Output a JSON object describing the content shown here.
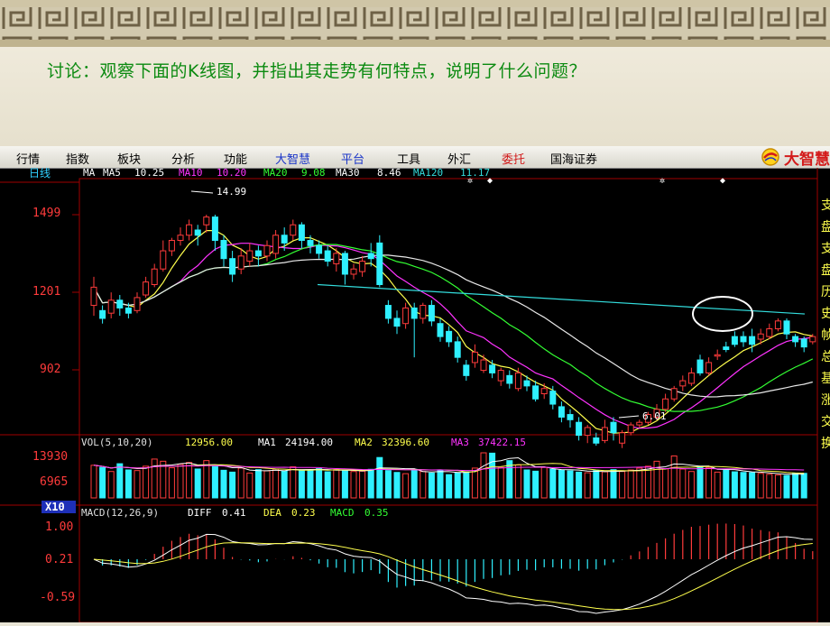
{
  "slide": {
    "question": "讨论：观察下面的K线图，并指出其走势有何特点，说明了什么问题？"
  },
  "menu": {
    "items": [
      {
        "label": "行情",
        "style": "normal"
      },
      {
        "label": "指数",
        "style": "normal"
      },
      {
        "label": "板块",
        "style": "normal"
      },
      {
        "label": "分析",
        "style": "normal"
      },
      {
        "label": "功能",
        "style": "normal"
      },
      {
        "label": "大智慧",
        "style": "blue"
      },
      {
        "label": "平台",
        "style": "blue"
      },
      {
        "label": "工具",
        "style": "normal"
      },
      {
        "label": "外汇",
        "style": "normal"
      },
      {
        "label": "委托",
        "style": "red"
      },
      {
        "label": "国海证券",
        "style": "normal"
      }
    ],
    "logo_text": "大智慧"
  },
  "colors": {
    "up": "#ff3b3b",
    "down": "#2ff0ff",
    "ma5": "#e8e8e8",
    "ma10": "#ffff4d",
    "ma20": "#ff33ff",
    "ma30": "#33ff33",
    "ma120": "#33dddd",
    "axis": "#c00000",
    "question": "#0b8a10"
  },
  "price_panel": {
    "period_label": "日线",
    "ma_prefix": "MA",
    "ma_legend": [
      {
        "label": "MA5",
        "value": "10.25",
        "color": "#ffffff"
      },
      {
        "label": "MA10",
        "value": "10.20",
        "color": "#ffff4d"
      },
      {
        "label": "MA20",
        "value": "9.08",
        "color": "#ff33ff"
      },
      {
        "label": "MA30",
        "value": "8.46",
        "color": "#33ff33"
      },
      {
        "label": "MA120",
        "value": "11.17",
        "color": "#33dddd"
      }
    ],
    "y_ticks": [
      "1499",
      "1201",
      "902"
    ],
    "high_label": "14.99",
    "low_label": "6.01",
    "right_glyphs": [
      "支",
      "盘",
      "支",
      "盘",
      "历",
      "史",
      "帧",
      "总",
      "基",
      "涨",
      "交",
      "换"
    ]
  },
  "volume_panel": {
    "title": "VOL(5,10,20)",
    "vol_value": "12956.00",
    "ma1_label": "MA1",
    "ma1_value": "24194.00",
    "ma2_label": "MA2",
    "ma2_value": "32396.60",
    "ma3_label": "MA3",
    "ma3_value": "37422.15",
    "y_ticks": [
      "13930",
      "6965"
    ],
    "unit": "X10"
  },
  "macd_panel": {
    "title": "MACD(12,26,9)",
    "diff_label": "DIFF",
    "diff_value": "0.41",
    "dea_label": "DEA",
    "dea_value": "0.23",
    "macd_label": "MACD",
    "macd_value": "0.35",
    "y_ticks": [
      "1.00",
      "0.21",
      "-0.59"
    ]
  },
  "chart_data": {
    "type": "candlestick",
    "period": "daily",
    "price_axis_ticks": [
      14.99,
      12.01,
      9.02
    ],
    "marked_high": 14.99,
    "marked_low": 6.01,
    "candles": [
      {
        "o": 11.5,
        "c": 12.2,
        "h": 12.6,
        "l": 11.1
      },
      {
        "o": 11.3,
        "c": 11.0,
        "h": 11.5,
        "l": 10.8
      },
      {
        "o": 11.2,
        "c": 11.7,
        "h": 12.0,
        "l": 11.0
      },
      {
        "o": 11.7,
        "c": 11.4,
        "h": 11.9,
        "l": 11.1
      },
      {
        "o": 11.4,
        "c": 11.2,
        "h": 11.6,
        "l": 11.0
      },
      {
        "o": 11.3,
        "c": 11.8,
        "h": 12.0,
        "l": 11.2
      },
      {
        "o": 11.9,
        "c": 12.4,
        "h": 12.6,
        "l": 11.8
      },
      {
        "o": 12.3,
        "c": 12.9,
        "h": 13.1,
        "l": 12.2
      },
      {
        "o": 12.9,
        "c": 13.6,
        "h": 14.0,
        "l": 12.8
      },
      {
        "o": 13.6,
        "c": 14.0,
        "h": 14.1,
        "l": 13.4
      },
      {
        "o": 14.0,
        "c": 14.2,
        "h": 14.5,
        "l": 13.8
      },
      {
        "o": 14.2,
        "c": 14.6,
        "h": 14.8,
        "l": 14.0
      },
      {
        "o": 14.4,
        "c": 14.2,
        "h": 14.6,
        "l": 13.8
      },
      {
        "o": 14.6,
        "c": 14.9,
        "h": 14.99,
        "l": 14.3
      },
      {
        "o": 14.9,
        "c": 14.0,
        "h": 14.99,
        "l": 13.6
      },
      {
        "o": 14.0,
        "c": 13.3,
        "h": 14.2,
        "l": 13.0
      },
      {
        "o": 13.3,
        "c": 12.7,
        "h": 13.6,
        "l": 12.4
      },
      {
        "o": 12.9,
        "c": 13.4,
        "h": 13.7,
        "l": 12.7
      },
      {
        "o": 13.2,
        "c": 13.6,
        "h": 13.9,
        "l": 13.0
      },
      {
        "o": 13.6,
        "c": 13.4,
        "h": 13.8,
        "l": 13.0
      },
      {
        "o": 13.4,
        "c": 13.8,
        "h": 14.0,
        "l": 13.2
      },
      {
        "o": 13.5,
        "c": 14.2,
        "h": 14.4,
        "l": 13.3
      },
      {
        "o": 14.2,
        "c": 13.9,
        "h": 14.5,
        "l": 13.6
      },
      {
        "o": 14.2,
        "c": 14.6,
        "h": 14.8,
        "l": 14.0
      },
      {
        "o": 14.6,
        "c": 14.0,
        "h": 14.7,
        "l": 13.7
      },
      {
        "o": 14.0,
        "c": 13.8,
        "h": 14.2,
        "l": 13.5
      },
      {
        "o": 13.8,
        "c": 13.5,
        "h": 14.0,
        "l": 13.3
      },
      {
        "o": 13.6,
        "c": 13.2,
        "h": 13.8,
        "l": 13.0
      },
      {
        "o": 13.1,
        "c": 13.5,
        "h": 13.7,
        "l": 12.8
      },
      {
        "o": 13.5,
        "c": 12.7,
        "h": 13.6,
        "l": 12.3
      },
      {
        "o": 12.7,
        "c": 12.9,
        "h": 13.1,
        "l": 12.5
      },
      {
        "o": 12.8,
        "c": 13.2,
        "h": 13.4,
        "l": 12.6
      },
      {
        "o": 13.5,
        "c": 13.3,
        "h": 13.9,
        "l": 13.0
      },
      {
        "o": 13.9,
        "c": 12.3,
        "h": 14.2,
        "l": 12.2
      },
      {
        "o": 11.5,
        "c": 11.0,
        "h": 11.7,
        "l": 10.8
      },
      {
        "o": 11.0,
        "c": 10.7,
        "h": 11.3,
        "l": 10.4
      },
      {
        "o": 10.8,
        "c": 11.4,
        "h": 11.6,
        "l": 10.6
      },
      {
        "o": 11.4,
        "c": 11.0,
        "h": 11.6,
        "l": 9.5
      },
      {
        "o": 11.0,
        "c": 11.5,
        "h": 11.6,
        "l": 10.8
      },
      {
        "o": 11.5,
        "c": 10.9,
        "h": 11.7,
        "l": 10.7
      },
      {
        "o": 10.8,
        "c": 10.3,
        "h": 11.0,
        "l": 10.1
      },
      {
        "o": 10.5,
        "c": 10.1,
        "h": 10.7,
        "l": 9.9
      },
      {
        "o": 10.1,
        "c": 9.5,
        "h": 10.3,
        "l": 9.3
      },
      {
        "o": 9.2,
        "c": 8.8,
        "h": 9.4,
        "l": 8.6
      },
      {
        "o": 9.3,
        "c": 9.7,
        "h": 10.0,
        "l": 9.1
      },
      {
        "o": 9.0,
        "c": 9.4,
        "h": 9.6,
        "l": 8.9
      },
      {
        "o": 9.2,
        "c": 8.9,
        "h": 9.4,
        "l": 8.7
      },
      {
        "o": 8.6,
        "c": 9.0,
        "h": 9.1,
        "l": 8.4
      },
      {
        "o": 8.8,
        "c": 8.5,
        "h": 9.0,
        "l": 8.3
      },
      {
        "o": 8.3,
        "c": 8.9,
        "h": 9.1,
        "l": 8.2
      },
      {
        "o": 8.6,
        "c": 8.4,
        "h": 8.8,
        "l": 8.2
      },
      {
        "o": 8.4,
        "c": 7.9,
        "h": 8.6,
        "l": 7.8
      },
      {
        "o": 8.1,
        "c": 8.3,
        "h": 8.5,
        "l": 7.9
      },
      {
        "o": 8.2,
        "c": 7.7,
        "h": 8.4,
        "l": 7.5
      },
      {
        "o": 7.6,
        "c": 7.2,
        "h": 7.8,
        "l": 7.0
      },
      {
        "o": 7.3,
        "c": 7.1,
        "h": 7.5,
        "l": 6.8
      },
      {
        "o": 7.0,
        "c": 6.5,
        "h": 7.2,
        "l": 6.3
      },
      {
        "o": 6.5,
        "c": 6.8,
        "h": 6.9,
        "l": 6.2
      },
      {
        "o": 6.4,
        "c": 6.2,
        "h": 6.6,
        "l": 6.1
      },
      {
        "o": 6.3,
        "c": 6.8,
        "h": 7.1,
        "l": 6.2
      },
      {
        "o": 7.0,
        "c": 6.6,
        "h": 7.2,
        "l": 6.3
      },
      {
        "o": 6.2,
        "c": 6.6,
        "h": 6.7,
        "l": 6.01
      },
      {
        "o": 6.6,
        "c": 6.9,
        "h": 7.0,
        "l": 6.5
      },
      {
        "o": 6.9,
        "c": 7.0,
        "h": 7.1,
        "l": 6.8
      },
      {
        "o": 7.0,
        "c": 7.3,
        "h": 7.4,
        "l": 6.9
      },
      {
        "o": 7.2,
        "c": 7.5,
        "h": 7.7,
        "l": 7.1
      },
      {
        "o": 7.5,
        "c": 7.9,
        "h": 8.1,
        "l": 7.4
      },
      {
        "o": 7.9,
        "c": 8.3,
        "h": 8.4,
        "l": 7.8
      },
      {
        "o": 8.4,
        "c": 8.6,
        "h": 8.8,
        "l": 8.2
      },
      {
        "o": 8.5,
        "c": 8.9,
        "h": 9.1,
        "l": 8.4
      },
      {
        "o": 9.4,
        "c": 8.9,
        "h": 9.6,
        "l": 8.8
      },
      {
        "o": 8.9,
        "c": 9.3,
        "h": 9.5,
        "l": 8.8
      },
      {
        "o": 9.6,
        "c": 9.6,
        "h": 9.8,
        "l": 9.4
      },
      {
        "o": 9.9,
        "c": 9.8,
        "h": 10.1,
        "l": 9.7
      },
      {
        "o": 10.3,
        "c": 10.0,
        "h": 10.5,
        "l": 9.9
      },
      {
        "o": 10.3,
        "c": 10.1,
        "h": 10.5,
        "l": 9.9
      },
      {
        "o": 10.3,
        "c": 10.0,
        "h": 10.6,
        "l": 9.7
      },
      {
        "o": 10.2,
        "c": 10.4,
        "h": 10.6,
        "l": 10.0
      },
      {
        "o": 10.3,
        "c": 10.6,
        "h": 10.8,
        "l": 10.2
      },
      {
        "o": 10.6,
        "c": 10.9,
        "h": 11.0,
        "l": 10.5
      },
      {
        "o": 10.9,
        "c": 10.4,
        "h": 11.0,
        "l": 10.2
      },
      {
        "o": 10.3,
        "c": 10.1,
        "h": 10.4,
        "l": 9.9
      },
      {
        "o": 10.2,
        "c": 9.9,
        "h": 10.3,
        "l": 9.7
      },
      {
        "o": 10.1,
        "c": 10.3,
        "h": 10.4,
        "l": 10.0
      }
    ],
    "volume_x10": [
      10500,
      9800,
      8500,
      11000,
      9000,
      8800,
      10200,
      12500,
      11800,
      9700,
      10800,
      11400,
      9300,
      12000,
      10100,
      8900,
      8300,
      9600,
      8000,
      9100,
      8700,
      9300,
      8600,
      10000,
      9000,
      8800,
      9400,
      8400,
      9100,
      8900,
      8500,
      8600,
      9200,
      13000,
      8800,
      8200,
      7800,
      9200,
      8500,
      8000,
      9000,
      7500,
      8100,
      8400,
      9600,
      17800,
      14400,
      9800,
      12000,
      10600,
      9000,
      8600,
      9800,
      9200,
      8900,
      8700,
      8300,
      8100,
      8800,
      8400,
      9100,
      8500,
      9000,
      9600,
      10200,
      11800,
      9400,
      13500,
      9300,
      8500,
      10200,
      9800,
      8300,
      8900,
      8400,
      8200,
      8100,
      7900,
      7600,
      7400,
      7200,
      8000,
      7900
    ]
  }
}
